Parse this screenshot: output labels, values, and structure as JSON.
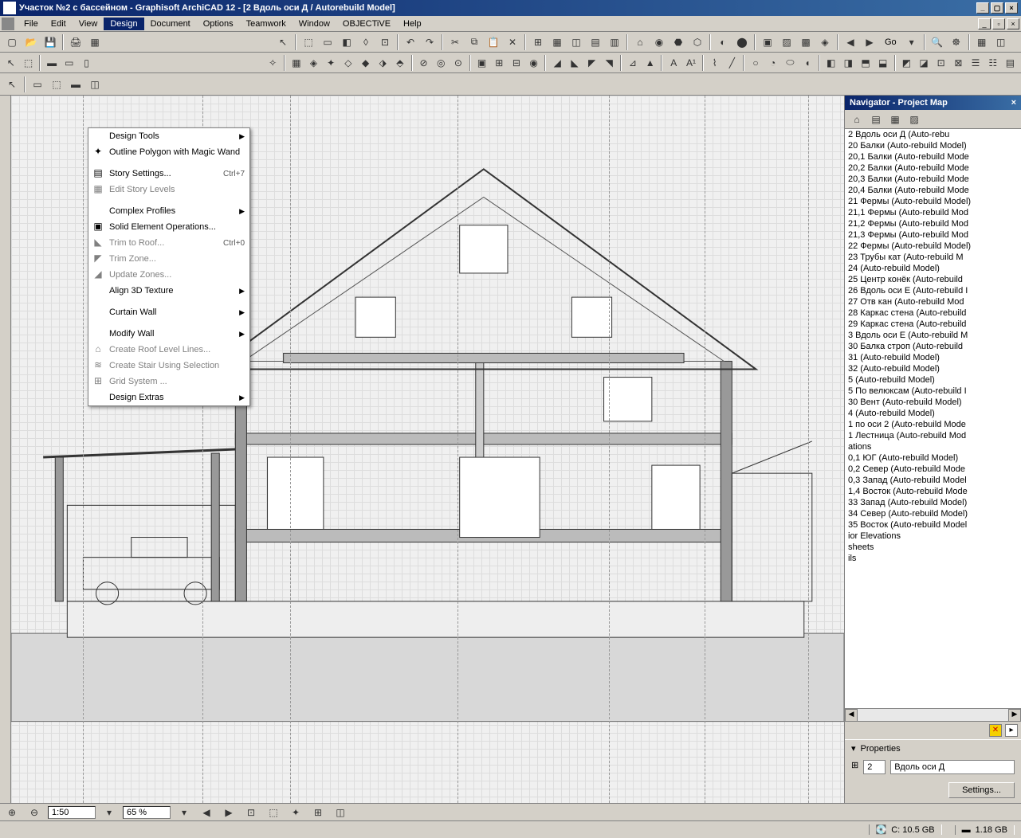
{
  "titlebar": {
    "text": "Участок №2 с бассейном  - Graphisoft ArchiCAD 12 - [2 Вдоль оси Д / Autorebuild Model]"
  },
  "menubar": {
    "items": [
      "File",
      "Edit",
      "View",
      "Design",
      "Document",
      "Options",
      "Teamwork",
      "Window",
      "OBJECTiVE",
      "Help"
    ],
    "active_index": 3
  },
  "dropdown": {
    "items": [
      {
        "label": "Design Tools",
        "arrow": true
      },
      {
        "label": "Outline Polygon with Magic Wand",
        "icon": "✦"
      },
      {
        "sep": true
      },
      {
        "label": "Story Settings...",
        "shortcut": "Ctrl+7",
        "icon": "▤"
      },
      {
        "label": "Edit Story Levels",
        "disabled": true,
        "icon": "▦"
      },
      {
        "sep": true
      },
      {
        "label": "Complex Profiles",
        "arrow": true
      },
      {
        "label": "Solid Element Operations...",
        "icon": "▣"
      },
      {
        "label": "Trim to Roof...",
        "shortcut": "Ctrl+0",
        "disabled": true,
        "icon": "◣"
      },
      {
        "label": "Trim Zone...",
        "disabled": true,
        "icon": "◤"
      },
      {
        "label": "Update Zones...",
        "disabled": true,
        "icon": "◢"
      },
      {
        "label": "Align 3D Texture",
        "arrow": true
      },
      {
        "sep": true
      },
      {
        "label": "Curtain Wall",
        "arrow": true
      },
      {
        "sep": true
      },
      {
        "label": "Modify Wall",
        "arrow": true
      },
      {
        "label": "Create Roof Level Lines...",
        "disabled": true,
        "icon": "⌂"
      },
      {
        "label": "Create Stair Using Selection",
        "disabled": true,
        "icon": "≋"
      },
      {
        "label": "Grid System ...",
        "disabled": true,
        "icon": "⊞"
      },
      {
        "label": "Design Extras",
        "arrow": true
      }
    ]
  },
  "toolbar1_go": "Go",
  "navigator": {
    "title": "Navigator - Project Map",
    "items": [
      "2 Вдоль оси Д (Auto-rebu",
      "20 Балки (Auto-rebuild Model)",
      "20,1 Балки (Auto-rebuild Mode",
      "20,2 Балки (Auto-rebuild Mode",
      "20,3 Балки (Auto-rebuild Mode",
      "20,4 Балки (Auto-rebuild Mode",
      "21 Фермы (Auto-rebuild Model)",
      "21,1 Фермы (Auto-rebuild Mod",
      "21,2 Фермы (Auto-rebuild Mod",
      "21,3 Фермы (Auto-rebuild Mod",
      "22 Фермы (Auto-rebuild Model)",
      "23 Трубы кат (Auto-rebuild M",
      "24 (Auto-rebuild Model)",
      "25 Центр конёк (Auto-rebuild",
      "26 Вдоль оси Е (Auto-rebuild I",
      "27 Отв кан (Auto-rebuild Mod",
      "28 Каркас стена (Auto-rebuild",
      "29 Каркас стена (Auto-rebuild",
      "3 Вдоль оси Е (Auto-rebuild M",
      "30 Балка строп (Auto-rebuild",
      "31 (Auto-rebuild Model)",
      "32 (Auto-rebuild Model)",
      "5 (Auto-rebuild Model)",
      "5 По велюксам (Auto-rebuild I",
      "30 Вент (Auto-rebuild Model)",
      "4 (Auto-rebuild Model)",
      "1 по оси 2 (Auto-rebuild Mode",
      "1 Лестница (Auto-rebuild Mod",
      "ations",
      "0,1 ЮГ (Auto-rebuild Model)",
      "0,2 Север (Auto-rebuild Mode",
      "0,3 Запад (Auto-rebuild Model",
      "1,4 Восток (Auto-rebuild Mode",
      "33 Запад (Auto-rebuild Model)",
      "34 Север (Auto-rebuild Model)",
      "35 Восток (Auto-rebuild Model",
      "ior Elevations",
      "sheets",
      "ils"
    ]
  },
  "properties": {
    "header": "Properties",
    "id": "2",
    "name": "Вдоль оси Д",
    "settings_btn": "Settings..."
  },
  "zoom": {
    "scale": "1:50",
    "percent": "65 %"
  },
  "status": {
    "c_drive": "C: 10.5 GB",
    "mem": "1.18 GB"
  }
}
